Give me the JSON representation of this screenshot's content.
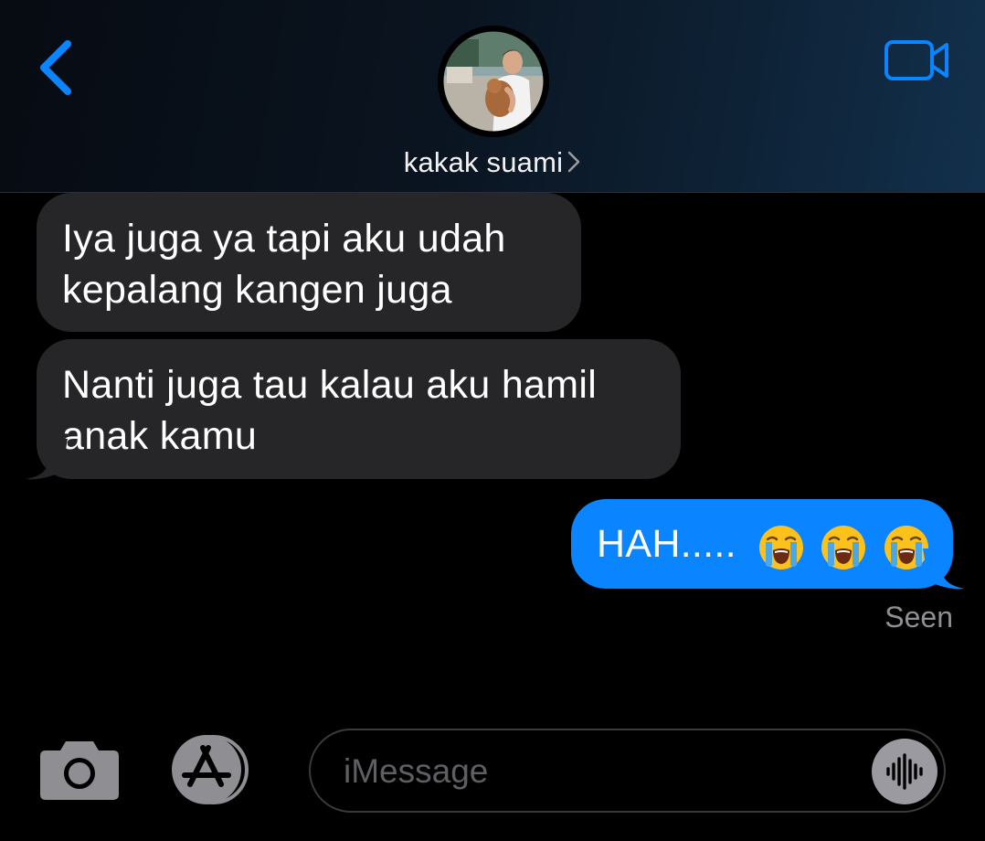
{
  "header": {
    "contact_name": "kakak suami",
    "accent_color": "#0a84ff"
  },
  "icons": {
    "back": "chevron-left-icon",
    "video": "video-camera-icon",
    "name_chevron": "chevron-right-icon",
    "camera": "camera-icon",
    "apps": "app-store-icon",
    "audio": "audio-waveform-icon"
  },
  "messages": [
    {
      "direction": "incoming",
      "lines": [
        "Iya juga ya tapi aku udah",
        "kepalang kangen juga"
      ]
    },
    {
      "direction": "incoming",
      "lines": [
        "Nanti juga tau kalau aku hamil",
        "anak kamu"
      ]
    },
    {
      "direction": "outgoing",
      "text": "HAH.....",
      "emoji": [
        "loudly-crying-face-emoji",
        "loudly-crying-face-emoji",
        "loudly-crying-face-emoji"
      ]
    }
  ],
  "status": {
    "seen_label": "Seen"
  },
  "composer": {
    "placeholder": "iMessage",
    "value": ""
  },
  "colors": {
    "incoming_bubble": "#262629",
    "outgoing_bubble": "#0a84ff",
    "secondary_text": "#8e8e93"
  }
}
